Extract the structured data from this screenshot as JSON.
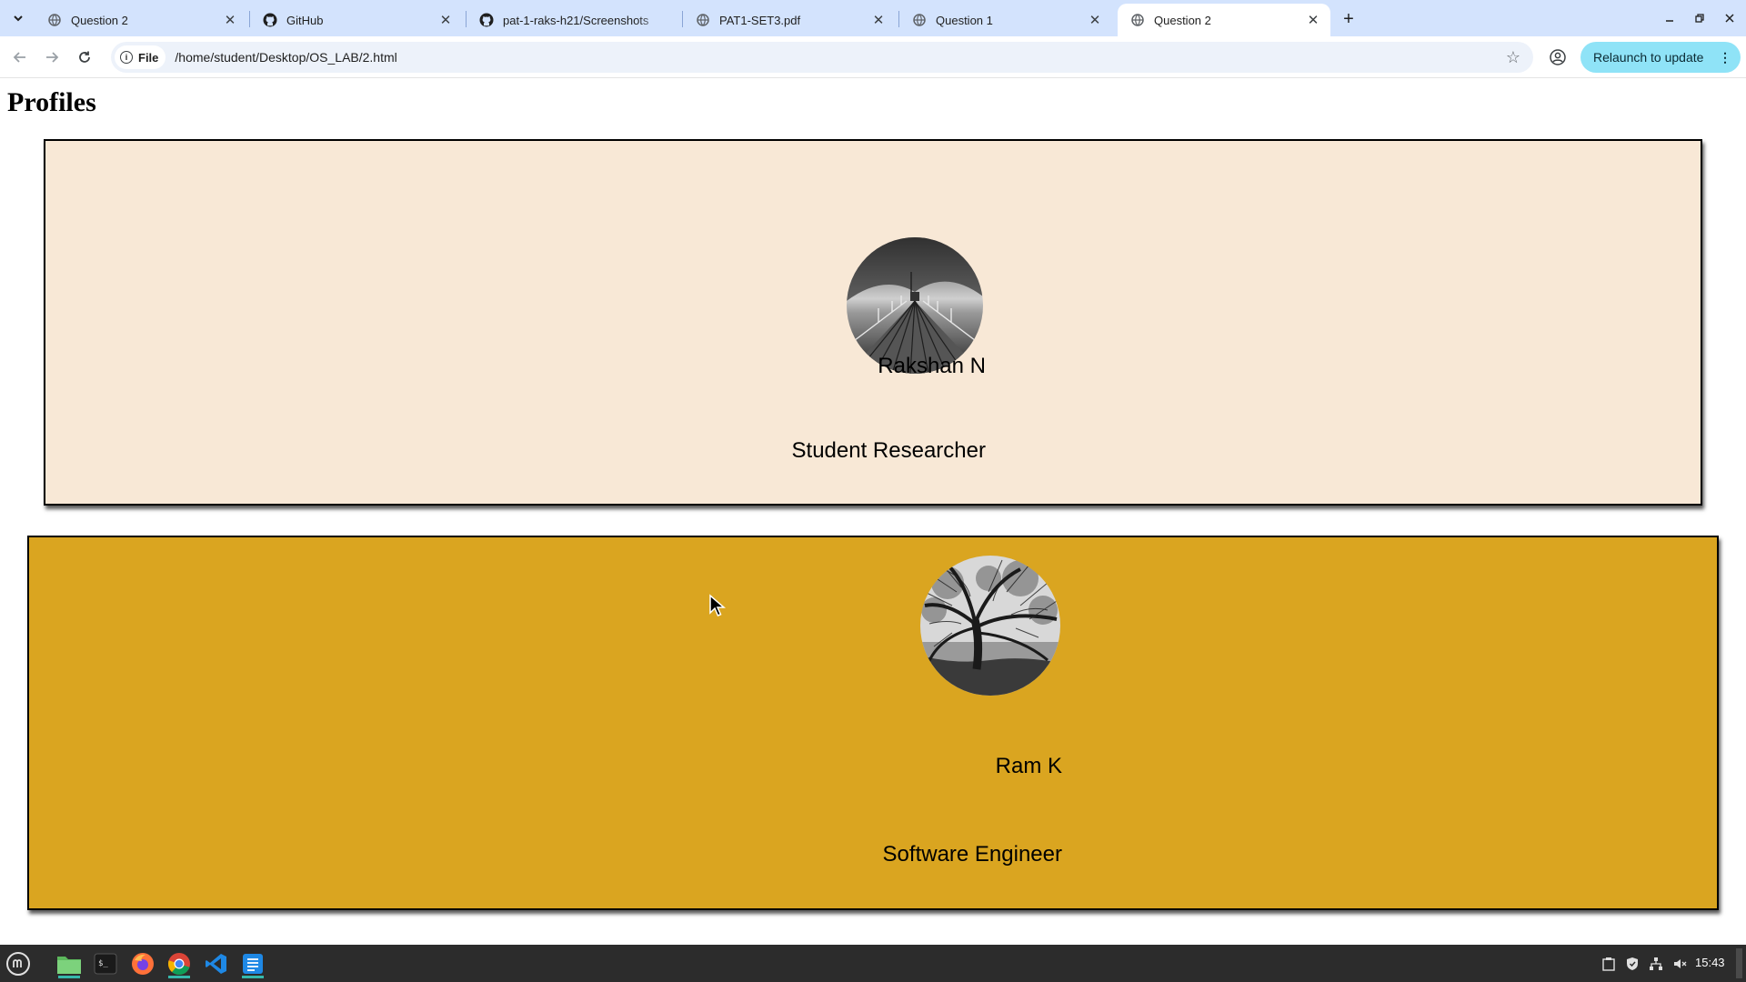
{
  "tabs": [
    {
      "title": "Question 2",
      "favicon": "globe-icon",
      "active": false
    },
    {
      "title": "GitHub",
      "favicon": "github-icon",
      "active": false
    },
    {
      "title": "pat-1-raks-h21/Screenshots",
      "favicon": "github-icon",
      "active": false
    },
    {
      "title": "PAT1-SET3.pdf",
      "favicon": "globe-icon",
      "active": false
    },
    {
      "title": "Question 1",
      "favicon": "globe-icon",
      "active": false
    },
    {
      "title": "Question 2",
      "favicon": "globe-icon",
      "active": true
    }
  ],
  "toolbar": {
    "chip_label": "File",
    "url": "/home/student/Desktop/OS_LAB/2.html",
    "relaunch_label": "Relaunch to update"
  },
  "page": {
    "heading": "Profiles",
    "profiles": [
      {
        "name": "Rakshan N",
        "role": "Student Researcher",
        "background": "#f8e8d6",
        "photo": "pier-photo"
      },
      {
        "name": "Ram K",
        "role": "Software Engineer",
        "background": "#daa520",
        "photo": "tree-photo"
      }
    ]
  },
  "taskbar": {
    "apps": [
      "menu-icon",
      "files-icon",
      "terminal-icon",
      "firefox-icon",
      "chrome-icon",
      "vscode-icon",
      "text-editor-icon"
    ],
    "clock": "15:43"
  },
  "colors": {
    "tabstrip": "#d3e3fd",
    "omnibox": "#edf2fa",
    "relaunch": "#8fe3f7",
    "taskbar": "#2c2c2c"
  }
}
